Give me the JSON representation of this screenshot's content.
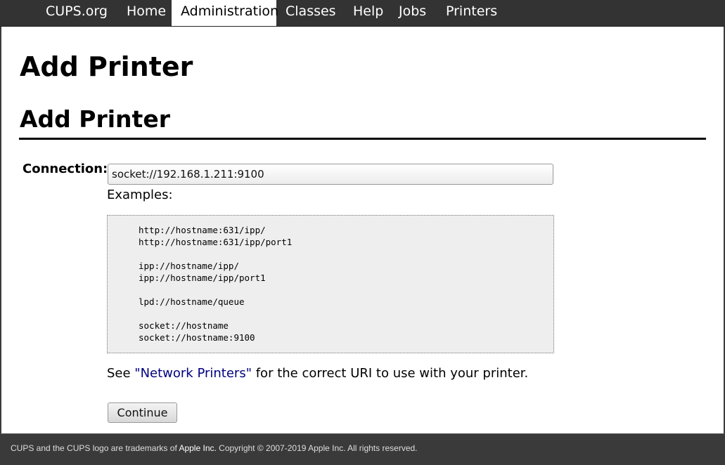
{
  "nav": {
    "items": [
      {
        "label": "CUPS.org",
        "active": false
      },
      {
        "label": "Home",
        "active": false
      },
      {
        "label": "Administration",
        "active": true
      },
      {
        "label": "Classes",
        "active": false
      },
      {
        "label": "Help",
        "active": false
      },
      {
        "label": "Jobs",
        "active": false
      },
      {
        "label": "Printers",
        "active": false
      }
    ]
  },
  "page": {
    "title": "Add Printer",
    "section_title": "Add Printer"
  },
  "form": {
    "connection_label": "Connection:",
    "connection_value": "socket://192.168.1.211:9100",
    "examples_label": "Examples:",
    "examples": [
      "http://hostname:631/ipp/",
      "http://hostname:631/ipp/port1",
      "",
      "ipp://hostname/ipp/",
      "ipp://hostname/ipp/port1",
      "",
      "lpd://hostname/queue",
      "",
      "socket://hostname",
      "socket://hostname:9100"
    ],
    "see_prefix": "See ",
    "see_link": "\"Network Printers\"",
    "see_suffix": " for the correct URI to use with your printer.",
    "continue_label": "Continue"
  },
  "footer": {
    "prefix": "CUPS and the CUPS logo are trademarks of ",
    "link": "Apple Inc.",
    "suffix": " Copyright © 2007-2019 Apple Inc. All rights reserved."
  },
  "colors": {
    "navbar_bg": "#333333",
    "link": "#000080",
    "footer_bg": "#3a3a3a"
  }
}
